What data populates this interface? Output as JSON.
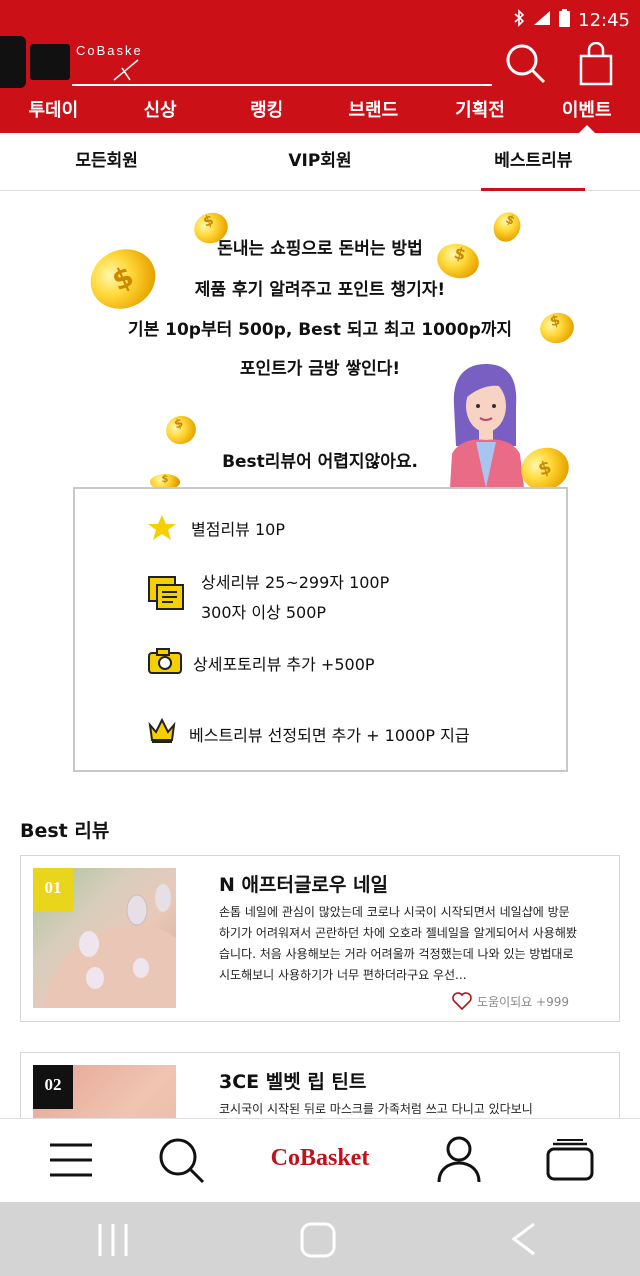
{
  "status": {
    "time": "12:45"
  },
  "header": {
    "logo_text": "CoBaske",
    "nav": [
      "투데이",
      "신상",
      "랭킹",
      "브랜드",
      "기획전",
      "이벤트"
    ],
    "active_nav_index": 5
  },
  "subtabs": {
    "items": [
      "모든회원",
      "VIP회원",
      "베스트리뷰"
    ],
    "active_index": 2
  },
  "promo": {
    "lines": [
      "돈내는 쇼핑으로 돈버는 방법",
      "제품 후기 알려주고 포인트 챙기자!",
      "기본 10p부터 500p, Best 되고 최고 1000p까지",
      "포인트가 금방 쌓인다!"
    ],
    "sub": "Best리뷰어 어렵지않아요."
  },
  "rules": [
    {
      "icon": "star-icon",
      "lines": [
        "별점리뷰 10P"
      ]
    },
    {
      "icon": "document-icon",
      "lines": [
        "상세리뷰 25~299자 100P",
        "300자 이상 500P"
      ]
    },
    {
      "icon": "camera-icon",
      "lines": [
        "상세포토리뷰 추가 +500P"
      ]
    },
    {
      "icon": "crown-icon",
      "lines": [
        "베스트리뷰 선정되면 추가 + 1000P 지급"
      ]
    }
  ],
  "best_section": {
    "title": "Best 리뷰"
  },
  "reviews": [
    {
      "rank": "01",
      "rank_color": "#e8d51c",
      "title": "N 애프터글로우 네일",
      "body": "손톱 네일에 관심이 많았는데 코로나 시국이 시작되면서 네일샵에 방문하기가 어려워져서 곤란하던 차에 오호라 젤네일을 알게되어서 사용해봤습니다. 처음 사용해보는 거라 어려울까 걱정했는데 나와 있는 방법대로 시도해보니 사용하기가 너무 편하더라구요 우선...",
      "helpful": "도움이되요 +999"
    },
    {
      "rank": "02",
      "rank_color": "#111111",
      "title": "3CE 벨벳 립 틴트",
      "body": "코시국이 시작된 뒤로 마스크를 가족처럼 쓰고 다니고 있다보니"
    }
  ],
  "bottom_bar": {
    "brand": "CoBasket"
  },
  "colors": {
    "brand_red": "#cc1018",
    "gold": "#f2c200"
  }
}
